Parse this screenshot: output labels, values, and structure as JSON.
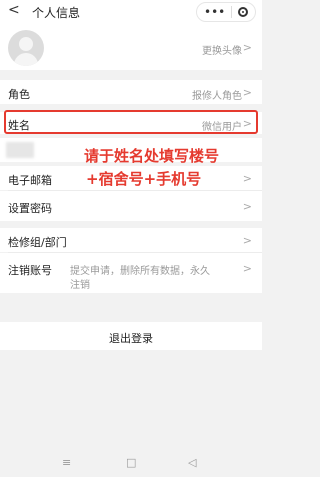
{
  "header": {
    "title": "个人信息",
    "back_glyph": "<"
  },
  "avatar": {
    "change_label": "更换头像"
  },
  "rows": {
    "role": {
      "label": "角色",
      "value": "报修人角色"
    },
    "name": {
      "label": "姓名",
      "value": "微信用户"
    },
    "email": {
      "label": "电子邮箱"
    },
    "password": {
      "label": "设置密码"
    },
    "group": {
      "label": "检修组/部门"
    },
    "cancel": {
      "label": "注销账号",
      "desc_line1": "提交申请，删除所有数据，永久",
      "desc_line2": "注销"
    }
  },
  "annotation": {
    "line1": "请于姓名处填写楼号",
    "line2": "+宿舍号+手机号"
  },
  "logout": {
    "label": "退出登录"
  },
  "navbar": {
    "menu": "≡",
    "home": "□",
    "back": "◁"
  },
  "colors": {
    "annotation_red": "#e53a2f",
    "background": "#f2f2f2"
  }
}
